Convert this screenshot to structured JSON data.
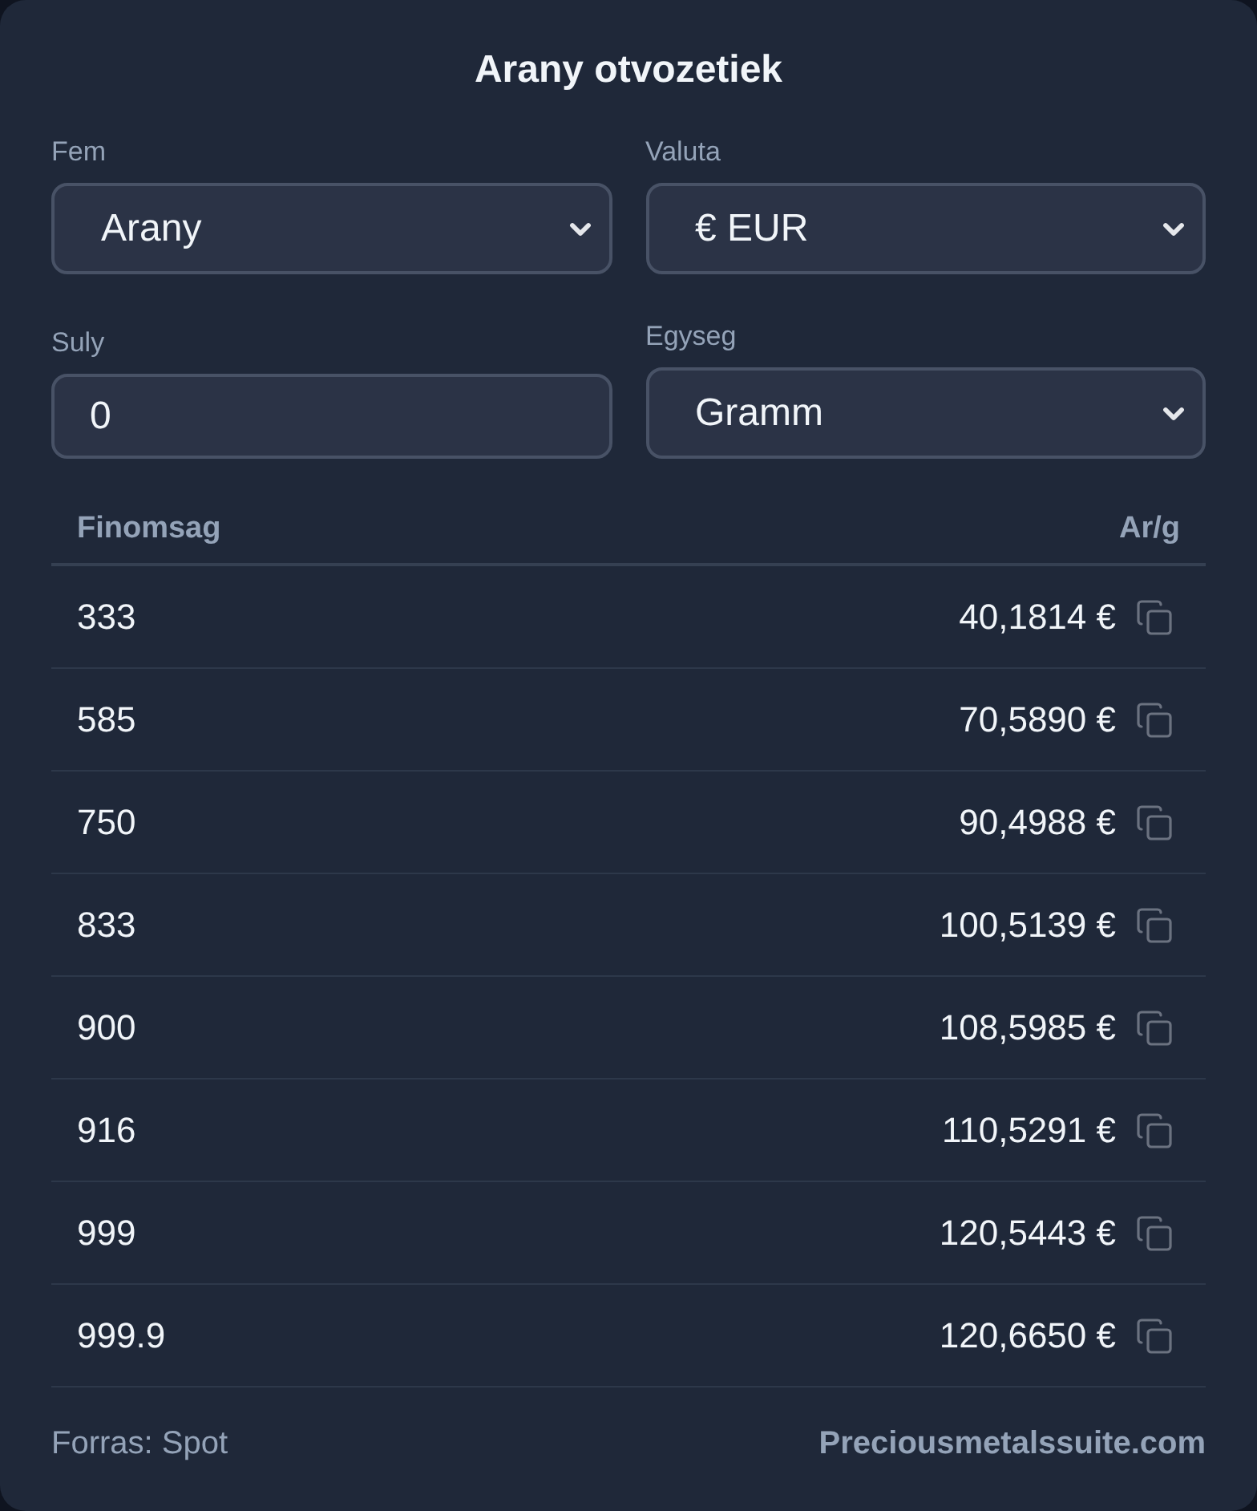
{
  "title": "Arany otvozetiek",
  "fields": [
    {
      "kind": "select",
      "label": "Fem",
      "value": "Arany"
    },
    {
      "kind": "select",
      "label": "Valuta",
      "value": "€ EUR"
    },
    {
      "kind": "input",
      "label": "Suly",
      "value": "0"
    },
    {
      "kind": "select",
      "label": "Egyseg",
      "value": "Gramm"
    }
  ],
  "table": {
    "columns": [
      "Finomsag",
      "Ar/g"
    ],
    "rows": [
      {
        "fineness": "333",
        "price": "40,1814 €"
      },
      {
        "fineness": "585",
        "price": "70,5890 €"
      },
      {
        "fineness": "750",
        "price": "90,4988 €"
      },
      {
        "fineness": "833",
        "price": "100,5139 €"
      },
      {
        "fineness": "900",
        "price": "108,5985 €"
      },
      {
        "fineness": "916",
        "price": "110,5291 €"
      },
      {
        "fineness": "999",
        "price": "120,5443 €"
      },
      {
        "fineness": "999.9",
        "price": "120,6650 €"
      }
    ]
  },
  "footer": {
    "source": "Forras: Spot",
    "link": "Preciousmetalssuite.com"
  }
}
